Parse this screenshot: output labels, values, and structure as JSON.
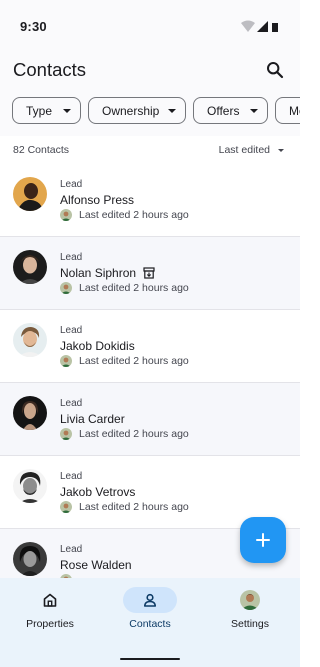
{
  "status_bar": {
    "time": "9:30"
  },
  "app_bar": {
    "title": "Contacts",
    "search_icon": "search-icon"
  },
  "filters": [
    {
      "label": "Type"
    },
    {
      "label": "Ownership"
    },
    {
      "label": "Offers"
    },
    {
      "label": "Mo"
    }
  ],
  "list_header": {
    "count": "82 Contacts",
    "sort_label": "Last edited"
  },
  "contacts": [
    {
      "type": "Lead",
      "name": "Alfonso Press",
      "edited": "Last edited 2 hours ago",
      "archived": false
    },
    {
      "type": "Lead",
      "name": "Nolan Siphron",
      "edited": "Last edited 2 hours ago",
      "archived": true
    },
    {
      "type": "Lead",
      "name": "Jakob Dokidis",
      "edited": "Last edited 2 hours ago",
      "archived": false
    },
    {
      "type": "Lead",
      "name": "Livia Carder",
      "edited": "Last edited 2 hours ago",
      "archived": false
    },
    {
      "type": "Lead",
      "name": "Jakob Vetrovs",
      "edited": "Last edited 2 hours ago",
      "archived": false
    },
    {
      "type": "Lead",
      "name": "Rose Walden",
      "edited": "",
      "archived": false
    }
  ],
  "fab": {
    "icon": "plus-icon"
  },
  "bottom_nav": {
    "items": [
      {
        "label": "Properties",
        "icon": "home-icon",
        "active": false
      },
      {
        "label": "Contacts",
        "icon": "person-icon",
        "active": true
      },
      {
        "label": "Settings",
        "icon": "avatar",
        "active": false
      }
    ]
  },
  "colors": {
    "accent": "#2196f3",
    "active_pill": "#cfe4fb",
    "nav_background": "#eaf3fb",
    "row_alt": "#f6f7fb"
  }
}
